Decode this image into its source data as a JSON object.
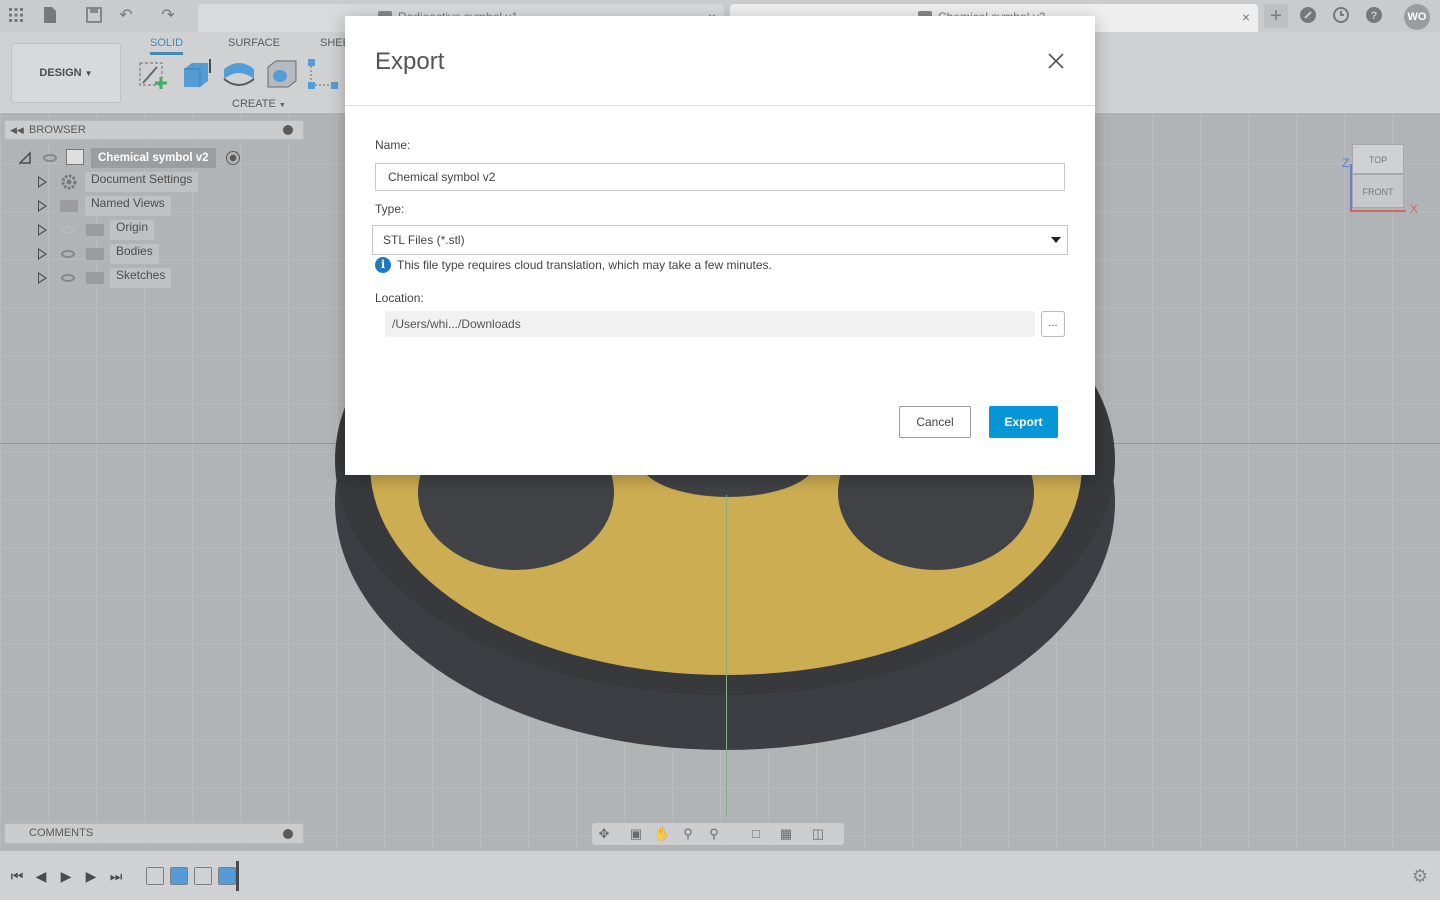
{
  "topbar": {
    "tabs": [
      {
        "label": "Radioactive symbol v1"
      },
      {
        "label": "Chemical symbol v2"
      }
    ],
    "user_initials": "WO"
  },
  "toolbar": {
    "workspace": "DESIGN",
    "mode_tabs": [
      "SOLID",
      "SURFACE",
      "SHEET METAL"
    ],
    "create_label": "CREATE"
  },
  "browser": {
    "title": "BROWSER",
    "root": "Chemical symbol v2",
    "items": [
      {
        "label": "Document Settings"
      },
      {
        "label": "Named Views"
      },
      {
        "label": "Origin"
      },
      {
        "label": "Bodies"
      },
      {
        "label": "Sketches"
      }
    ]
  },
  "comments": {
    "title": "COMMENTS"
  },
  "viewcube": {
    "top": "TOP",
    "front": "FRONT",
    "z": "Z",
    "x": "X"
  },
  "dialog": {
    "title": "Export",
    "name_label": "Name:",
    "name_value": "Chemical symbol v2",
    "type_label": "Type:",
    "type_value": "STL Files (*.stl)",
    "info_text": "This file type requires cloud translation, which may take a few minutes.",
    "location_label": "Location:",
    "location_value": "/Users/whi.../Downloads",
    "browse_label": "...",
    "cancel_label": "Cancel",
    "export_label": "Export"
  },
  "colors": {
    "accent": "#0696d7",
    "model_yellow": "#c6a23b",
    "model_black": "#1c1e22"
  }
}
